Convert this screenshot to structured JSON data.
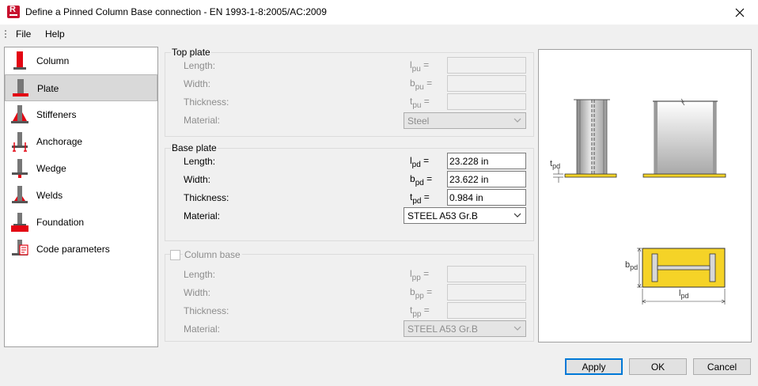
{
  "window": {
    "title": "Define a Pinned Column Base connection - EN 1993-1-8:2005/AC:2009",
    "app_icon_letter": "R"
  },
  "menu": {
    "file": "File",
    "help": "Help"
  },
  "nav": {
    "items": [
      {
        "label": "Column",
        "icon": "column-icon"
      },
      {
        "label": "Plate",
        "icon": "plate-icon",
        "selected": true
      },
      {
        "label": "Stiffeners",
        "icon": "stiffeners-icon"
      },
      {
        "label": "Anchorage",
        "icon": "anchorage-icon"
      },
      {
        "label": "Wedge",
        "icon": "wedge-icon"
      },
      {
        "label": "Welds",
        "icon": "welds-icon"
      },
      {
        "label": "Foundation",
        "icon": "foundation-icon"
      },
      {
        "label": "Code parameters",
        "icon": "code-parameters-icon"
      }
    ]
  },
  "top_plate": {
    "title": "Top plate",
    "length_label": "Length:",
    "length_sym": "l",
    "length_sub": "pu",
    "length_value": "",
    "width_label": "Width:",
    "width_sym": "b",
    "width_sub": "pu",
    "width_value": "",
    "thickness_label": "Thickness:",
    "thickness_sym": "t",
    "thickness_sub": "pu",
    "thickness_value": "",
    "material_label": "Material:",
    "material_value": "Steel"
  },
  "base_plate": {
    "title": "Base plate",
    "length_label": "Length:",
    "length_sym": "l",
    "length_sub": "pd",
    "length_value": "23.228 in",
    "width_label": "Width:",
    "width_sym": "b",
    "width_sub": "pd",
    "width_value": "23.622 in",
    "thickness_label": "Thickness:",
    "thickness_sym": "t",
    "thickness_sub": "pd",
    "thickness_value": "0.984 in",
    "material_label": "Material:",
    "material_value": "STEEL A53 Gr.B"
  },
  "column_base": {
    "title": "Column base",
    "checked": false,
    "length_label": "Length:",
    "length_sym": "l",
    "length_sub": "pp",
    "length_value": "",
    "width_label": "Width:",
    "width_sym": "b",
    "width_sub": "pp",
    "width_value": "",
    "thickness_label": "Thickness:",
    "thickness_sym": "t",
    "thickness_sub": "pp",
    "thickness_value": "",
    "material_label": "Material:",
    "material_value": "STEEL A53 Gr.B"
  },
  "preview": {
    "tpd_label": "t",
    "tpd_sub": "pd",
    "bpd_label": "b",
    "bpd_sub": "pd",
    "lpd_label": "l",
    "lpd_sub": "pd",
    "plate_color": "#f5d327"
  },
  "buttons": {
    "apply": "Apply",
    "ok": "OK",
    "cancel": "Cancel"
  },
  "colors": {
    "accent": "#0078d7",
    "icon_red": "#e30613"
  }
}
